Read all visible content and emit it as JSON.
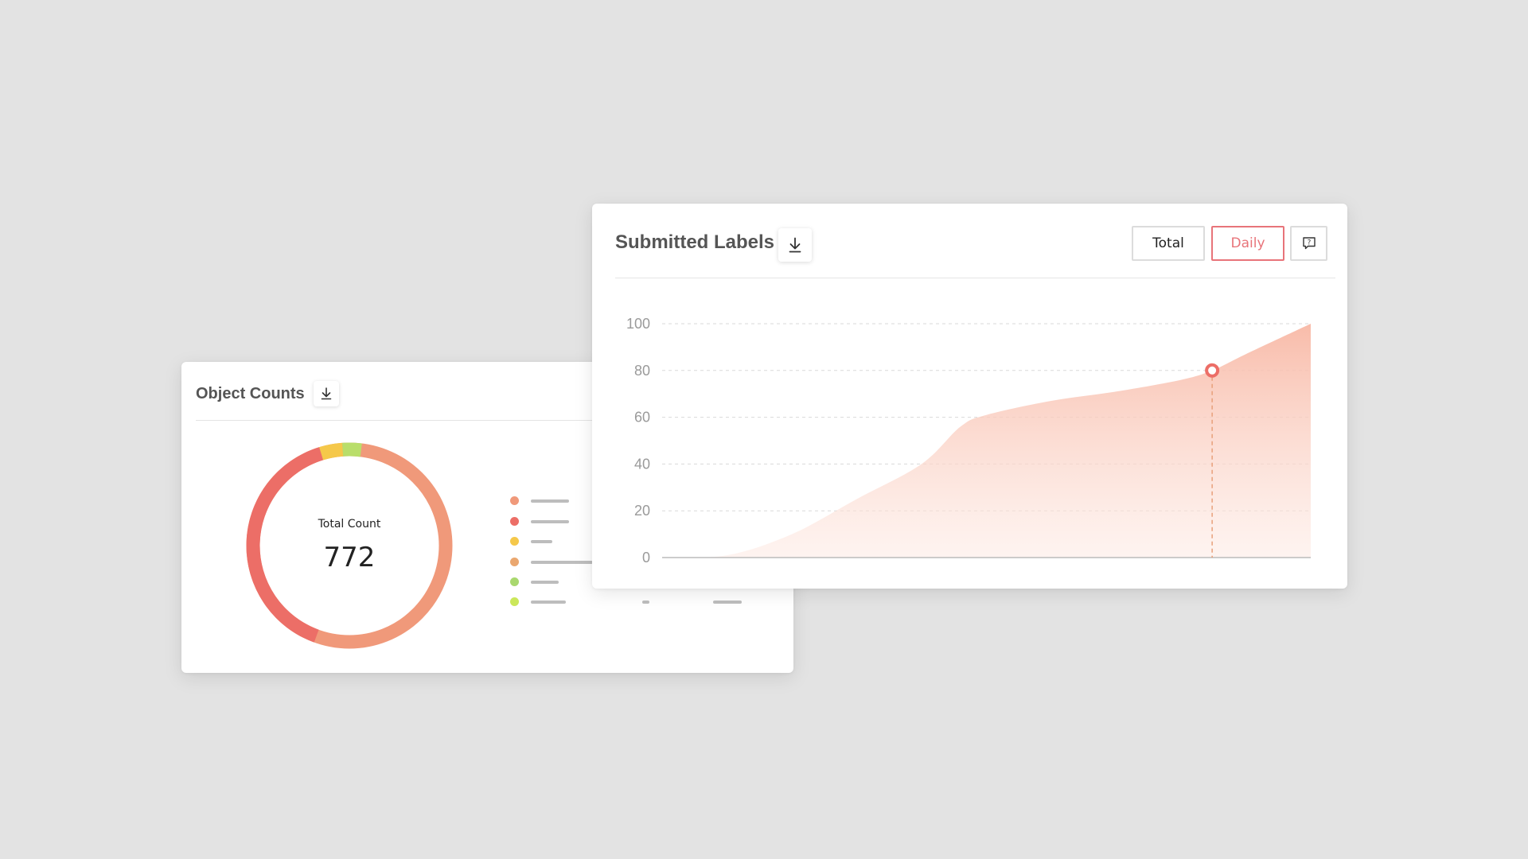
{
  "object_counts": {
    "title": "Object Counts",
    "download_icon": "download-icon",
    "total_label": "Total Count",
    "total_value": "772",
    "segment_colors": [
      "#f0997a",
      "#ec6e67",
      "#f5c84a",
      "#b9de6a"
    ],
    "legend_colors": [
      "#f0997a",
      "#ec6e67",
      "#f5c84a",
      "#eaa76f",
      "#a9d86e",
      "#cbe75a"
    ]
  },
  "submitted_labels": {
    "title": "Submitted Labels",
    "download_icon": "download-icon",
    "buttons": {
      "total": "Total",
      "daily": "Daily",
      "help_icon": "comment-question-icon"
    },
    "active_button": "daily",
    "accent_color": "#e8747a",
    "area_color": "#f8b8a5"
  },
  "chart_data": {
    "type": "area",
    "title": "",
    "xlabel": "",
    "ylabel": "",
    "ylim": [
      0,
      100
    ],
    "yticks": [
      "100",
      "80",
      "60",
      "40",
      "20",
      "0"
    ],
    "grid": true,
    "x": [
      0,
      0.1,
      0.2,
      0.3,
      0.4,
      0.46,
      0.5,
      0.6,
      0.7,
      0.8,
      0.848,
      0.9,
      1.0
    ],
    "series": [
      {
        "values": [
          0,
          1,
          10,
          25,
          40,
          56,
          61,
          67,
          71,
          76,
          80,
          87,
          100
        ]
      }
    ],
    "highlight": {
      "x": 0.848,
      "y": 80
    }
  }
}
